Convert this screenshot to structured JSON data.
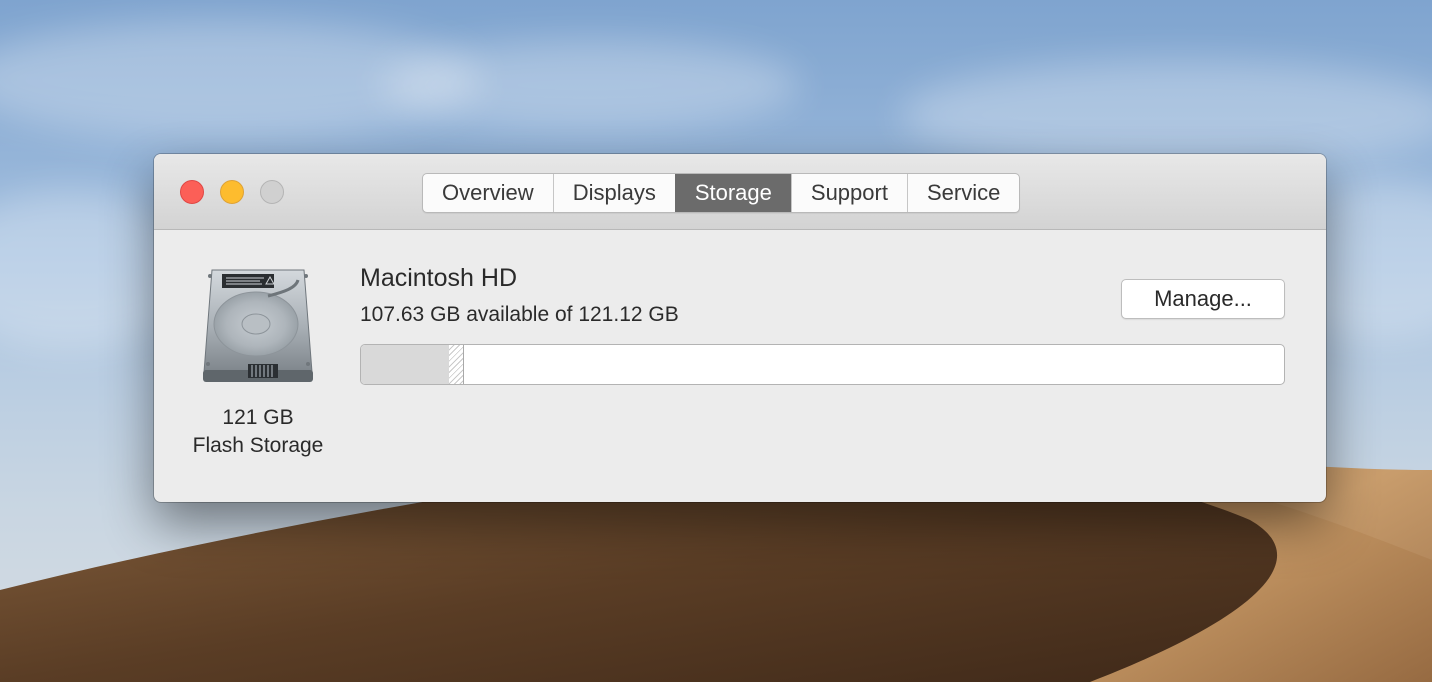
{
  "window": {
    "tabs": [
      {
        "label": "Overview",
        "active": false
      },
      {
        "label": "Displays",
        "active": false
      },
      {
        "label": "Storage",
        "active": true
      },
      {
        "label": "Support",
        "active": false
      },
      {
        "label": "Service",
        "active": false
      }
    ]
  },
  "drive": {
    "icon": "hard-drive-icon",
    "size_label": "121 GB",
    "type_label": "Flash Storage"
  },
  "volume": {
    "name": "Macintosh HD",
    "availability": "107.63 GB available of 121.12 GB",
    "available_gb": 107.63,
    "total_gb": 121.12,
    "used_fraction": 0.095,
    "other_fraction": 0.016
  },
  "manage_button": {
    "label": "Manage..."
  },
  "colors": {
    "close": "#fc5f57",
    "minimize": "#fdbc2e",
    "zoom_inactive": "#d0d0d0",
    "active_tab": "#6b6b6b"
  }
}
